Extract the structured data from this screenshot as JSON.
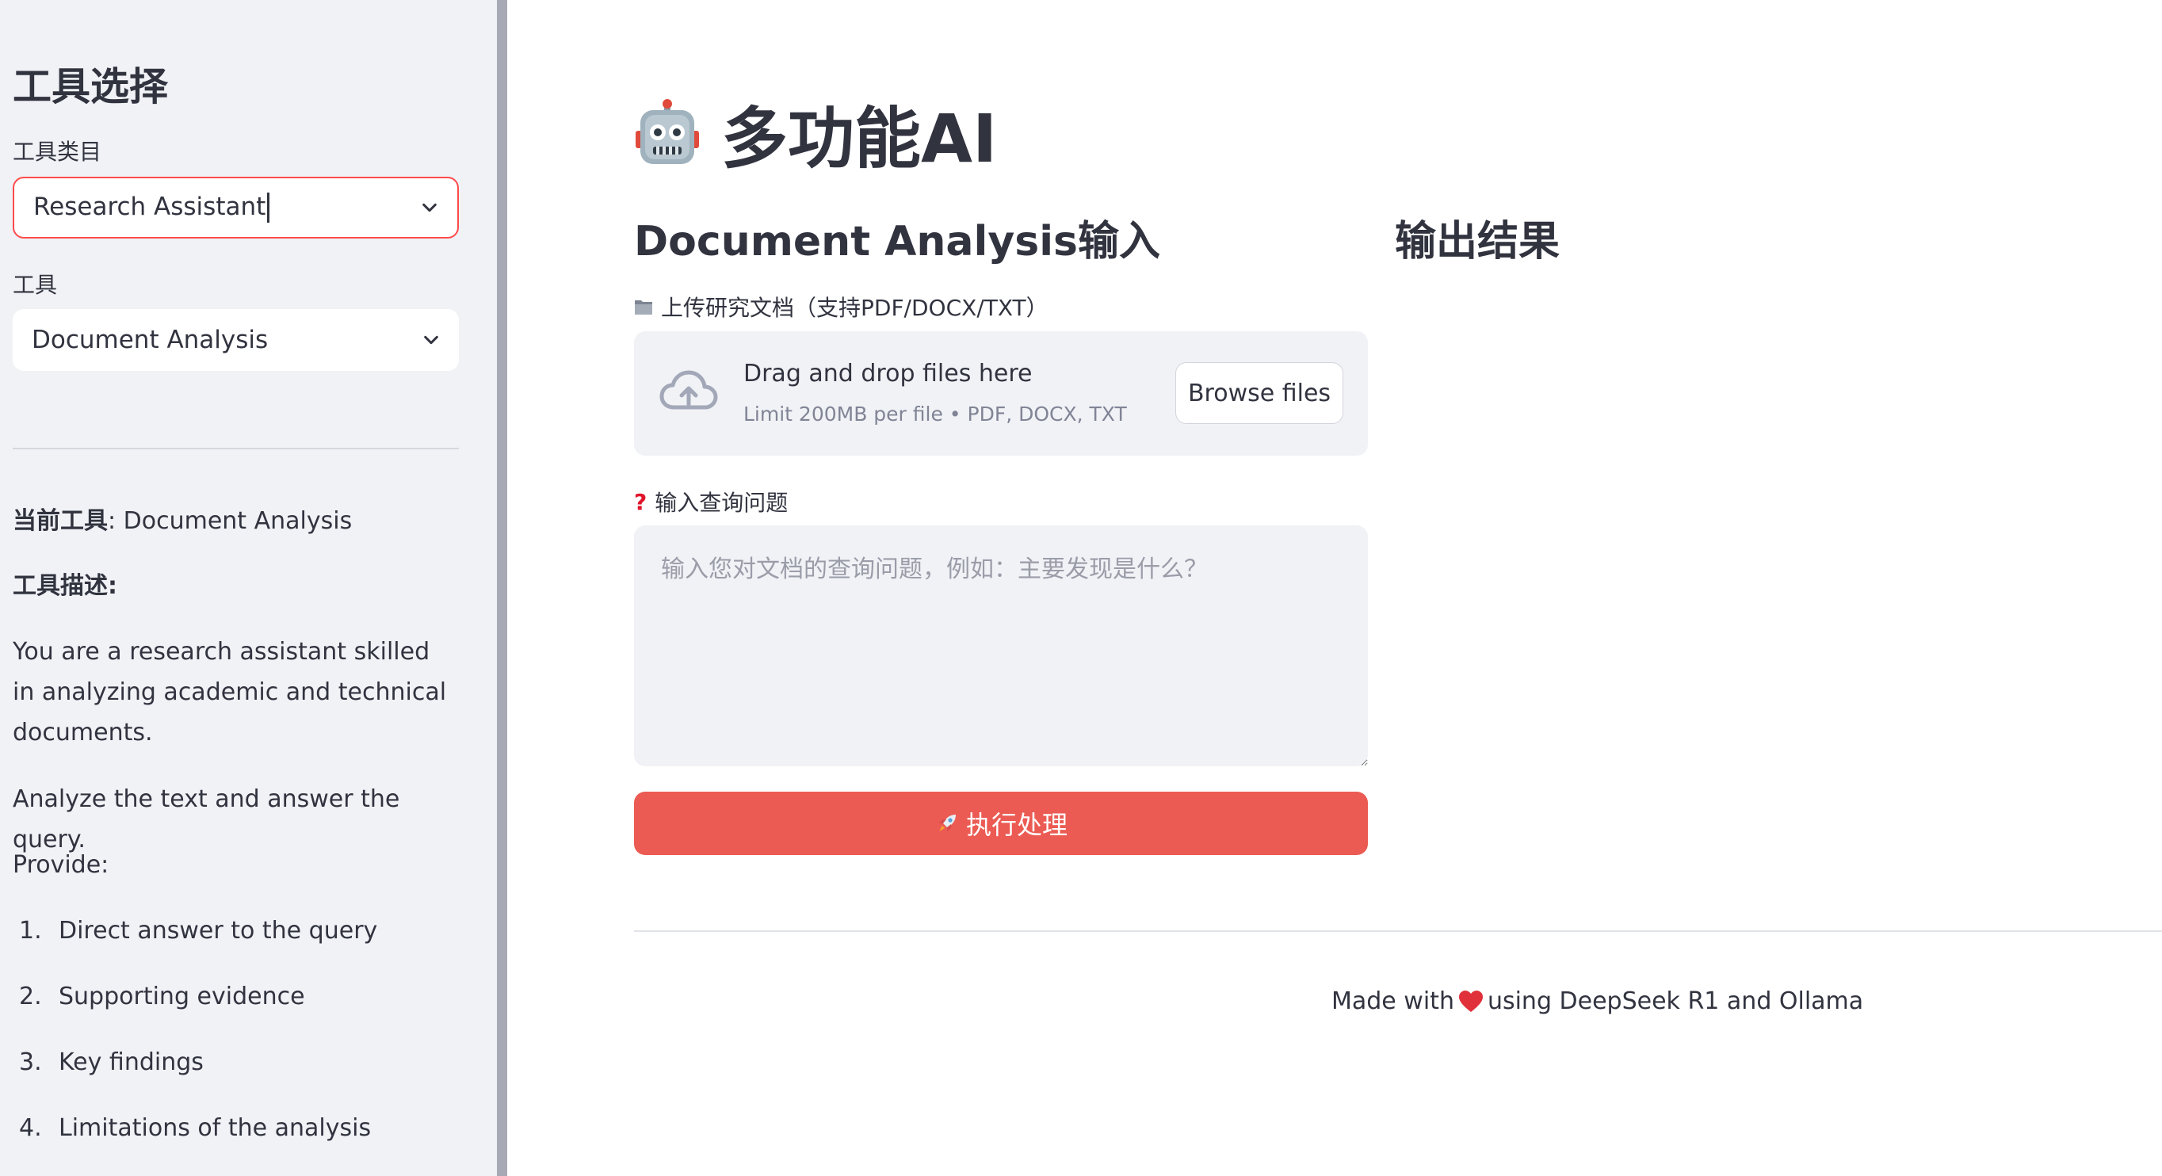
{
  "sidebar": {
    "title": "工具选择",
    "category_label": "工具类目",
    "category_value": "Research Assistant",
    "tool_label": "工具",
    "tool_value": "Document Analysis",
    "current_tool_key": "当前工具",
    "current_tool_value": ": Document Analysis",
    "description_key": "工具描述:",
    "description_text": "You are a research assistant skilled in analyzing academic and technical documents.",
    "instruction": "Analyze the text and answer the query.",
    "provide_label": "Provide:",
    "list_items": [
      {
        "num": "1.",
        "text": "Direct answer to the query"
      },
      {
        "num": "2.",
        "text": "Supporting evidence"
      },
      {
        "num": "3.",
        "text": "Key findings"
      },
      {
        "num": "4.",
        "text": "Limitations of the analysis"
      }
    ]
  },
  "main": {
    "title": "多功能AI",
    "input_section_title": "Document Analysis输入",
    "output_section_title": "输出结果",
    "upload_label": "上传研究文档（支持PDF/DOCX/TXT）",
    "uploader": {
      "drop_text": "Drag and drop files here",
      "limit_text": "Limit 200MB per file • PDF, DOCX, TXT",
      "browse_label": "Browse files"
    },
    "query_label": "输入查询问题",
    "query_placeholder": "输入您对文档的查询问题，例如：主要发现是什么？",
    "query_value": "",
    "run_button_label": "执行处理"
  },
  "footer": {
    "prefix": "Made with",
    "suffix": "using DeepSeek R1 and Ollama"
  },
  "icons": {
    "title_icon": "robot-icon",
    "upload_icon": "folder-icon",
    "query_icon": "question-mark-icon",
    "uploader_icon": "cloud-upload-icon",
    "run_icon": "rocket-icon",
    "footer_icon": "heart-icon",
    "select_icon": "chevron-down-icon"
  },
  "colors": {
    "accent": "#ff4b4b",
    "run_button": "#eb5b53",
    "sidebar_bg": "#f0f2f6",
    "text": "#31333f",
    "muted": "#808495"
  }
}
